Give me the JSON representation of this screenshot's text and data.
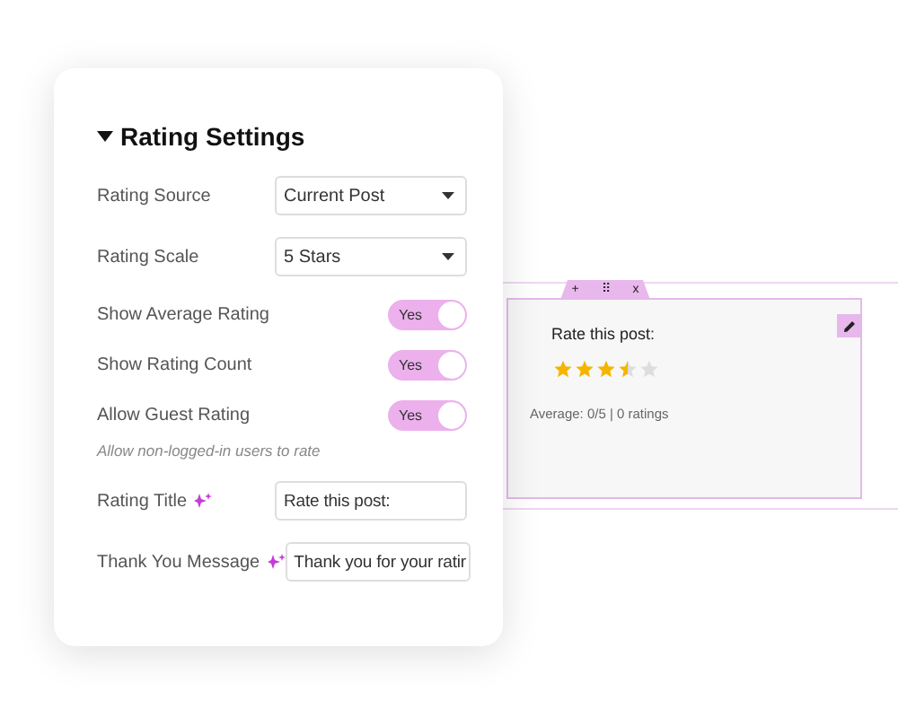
{
  "settings": {
    "title": "Rating Settings",
    "rows": [
      {
        "kind": "select",
        "label": "Rating Source",
        "value": "Current Post"
      },
      {
        "kind": "select",
        "label": "Rating Scale",
        "value": "5 Stars"
      },
      {
        "kind": "toggle",
        "label": "Show Average Rating",
        "on": true,
        "toggle_text": "Yes"
      },
      {
        "kind": "toggle",
        "label": "Show Rating Count",
        "on": true,
        "toggle_text": "Yes"
      },
      {
        "kind": "toggle",
        "label": "Allow Guest Rating",
        "on": true,
        "toggle_text": "Yes"
      },
      {
        "kind": "hint",
        "label": "Allow non-logged-in users to rate"
      },
      {
        "kind": "text",
        "label": "Rating Title",
        "value": "Rate this post:"
      },
      {
        "kind": "text",
        "label": "Thank You Message",
        "value": "Thank you for your ratir"
      }
    ]
  },
  "preview": {
    "toolbar": [
      "+",
      "⠿",
      "x"
    ],
    "title": "Rate this post:",
    "stars": 3.5,
    "summary": "Average: 0/5 | 0 ratings"
  }
}
